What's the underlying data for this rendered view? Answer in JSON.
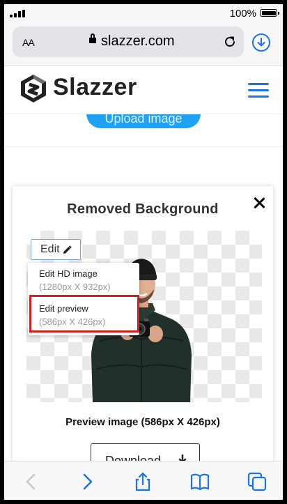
{
  "status_bar": {
    "battery_text": "100%"
  },
  "browser": {
    "text_size_label": "AA",
    "url": "slazzer.com"
  },
  "site": {
    "brand": "Slazzer",
    "upload_button": "Upload image"
  },
  "card": {
    "title": "Removed Background",
    "edit_button": "Edit",
    "menu": [
      {
        "title": "Edit HD image",
        "subtitle": "(1280px X 932px)"
      },
      {
        "title": "Edit preview",
        "subtitle": "(586px X 426px)"
      }
    ],
    "preview_caption": "Preview image (586px X 426px)",
    "download_button": "Download"
  },
  "colors": {
    "accent": "#1a73e8",
    "upload": "#1fa2f4",
    "highlight": "#d42020"
  }
}
